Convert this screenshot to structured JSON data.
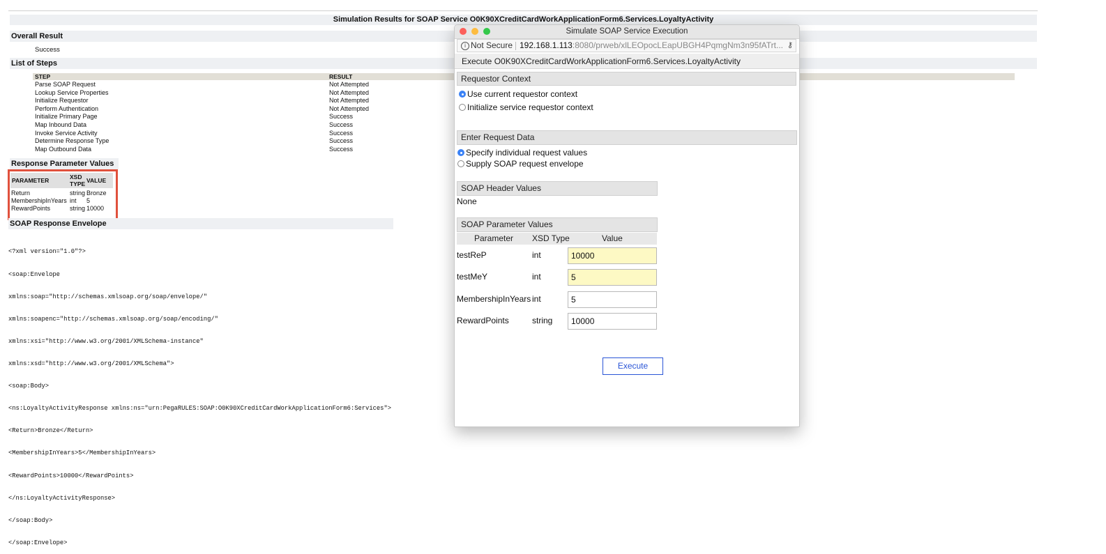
{
  "results": {
    "title": "Simulation Results for SOAP Service O0K90XCreditCardWorkApplicationForm6.Services.LoyaltyActivity",
    "overall_result_heading": "Overall Result",
    "overall_result_value": "Success",
    "list_of_steps_heading": "List of Steps",
    "steps_col_step": "STEP",
    "steps_col_result": "RESULT",
    "steps": [
      {
        "step": "Parse SOAP Request",
        "result": "Not Attempted"
      },
      {
        "step": "Lookup Service Properties",
        "result": "Not Attempted"
      },
      {
        "step": "Initialize Requestor",
        "result": "Not Attempted"
      },
      {
        "step": "Perform Authentication",
        "result": "Not Attempted"
      },
      {
        "step": "Initialize Primary Page",
        "result": "Success"
      },
      {
        "step": "Map Inbound Data",
        "result": "Success"
      },
      {
        "step": "Invoke Service Activity",
        "result": "Success"
      },
      {
        "step": "Determine Response Type",
        "result": "Success"
      },
      {
        "step": "Map Outbound Data",
        "result": "Success"
      }
    ],
    "response_params_heading": "Response Parameter Values",
    "rp_col_parameter": "PARAMETER",
    "rp_col_xsd_1": "XSD",
    "rp_col_xsd_2": "TYPE",
    "rp_col_value": "VALUE",
    "response_params": [
      {
        "name": "Return",
        "type": "string",
        "value": "Bronze"
      },
      {
        "name": "MembershipInYears",
        "type": "int",
        "value": "5"
      },
      {
        "name": "RewardPoints",
        "type": "string",
        "value": "10000"
      }
    ],
    "soap_envelope_heading": "SOAP Response Envelope",
    "soap_envelope_lines": [
      "<?xml version=\"1.0\"?>",
      "<soap:Envelope",
      "xmlns:soap=\"http://schemas.xmlsoap.org/soap/envelope/\"",
      "xmlns:soapenc=\"http://schemas.xmlsoap.org/soap/encoding/\"",
      "xmlns:xsi=\"http://www.w3.org/2001/XMLSchema-instance\"",
      "xmlns:xsd=\"http://www.w3.org/2001/XMLSchema\">",
      "<soap:Body>",
      "<ns:LoyaltyActivityResponse xmlns:ns=\"urn:PegaRULES:SOAP:O0K90XCreditCardWorkApplicationForm6:Services\">",
      "<Return>Bronze</Return>",
      "<MembershipInYears>5</MembershipInYears>",
      "<RewardPoints>10000</RewardPoints>",
      "</ns:LoyaltyActivityResponse>",
      "</soap:Body>",
      "</soap:Envelope>"
    ]
  },
  "modal": {
    "window_title": "Simulate SOAP Service Execution",
    "traffic_light_colors": {
      "close": "#fc605b",
      "minimize": "#fdbc40",
      "zoom": "#34c84a"
    },
    "url_bar": {
      "info_glyph": "i",
      "security_label": "Not Secure",
      "host": "192.168.1.113",
      "path": ":8080/prweb/xlLEOpocLEapUBGH4PqmgNm3n95fATrt...",
      "key_glyph": "⚷"
    },
    "execute_header": "Execute O0K90XCreditCardWorkApplicationForm6.Services.LoyaltyActivity",
    "requestor_context_heading": "Requestor Context",
    "requestor_options": [
      {
        "label": "Use current requestor context",
        "selected": true
      },
      {
        "label": "Initialize service requestor context",
        "selected": false
      }
    ],
    "request_data_heading": "Enter Request Data",
    "request_data_options": [
      {
        "label": "Specify individual request values",
        "selected": true
      },
      {
        "label": "Supply SOAP request envelope",
        "selected": false
      }
    ],
    "header_values_heading": "SOAP Header Values",
    "header_values_text": "None",
    "param_values_heading": "SOAP Parameter Values",
    "param_col_parameter": "Parameter",
    "param_col_xsd": "XSD Type",
    "param_col_value": "Value",
    "params": [
      {
        "name": "testReP",
        "type": "int",
        "value": "10000",
        "highlighted": true
      },
      {
        "name": "testMeY",
        "type": "int",
        "value": "5",
        "highlighted": true
      },
      {
        "name": "MembershipInYears",
        "type": "int",
        "value": "5",
        "highlighted": false
      },
      {
        "name": "RewardPoints",
        "type": "string",
        "value": "10000",
        "highlighted": false
      }
    ],
    "execute_button_label": "Execute",
    "accent_color": "#2a55d6",
    "highlight_color": "#fdf9c4"
  }
}
